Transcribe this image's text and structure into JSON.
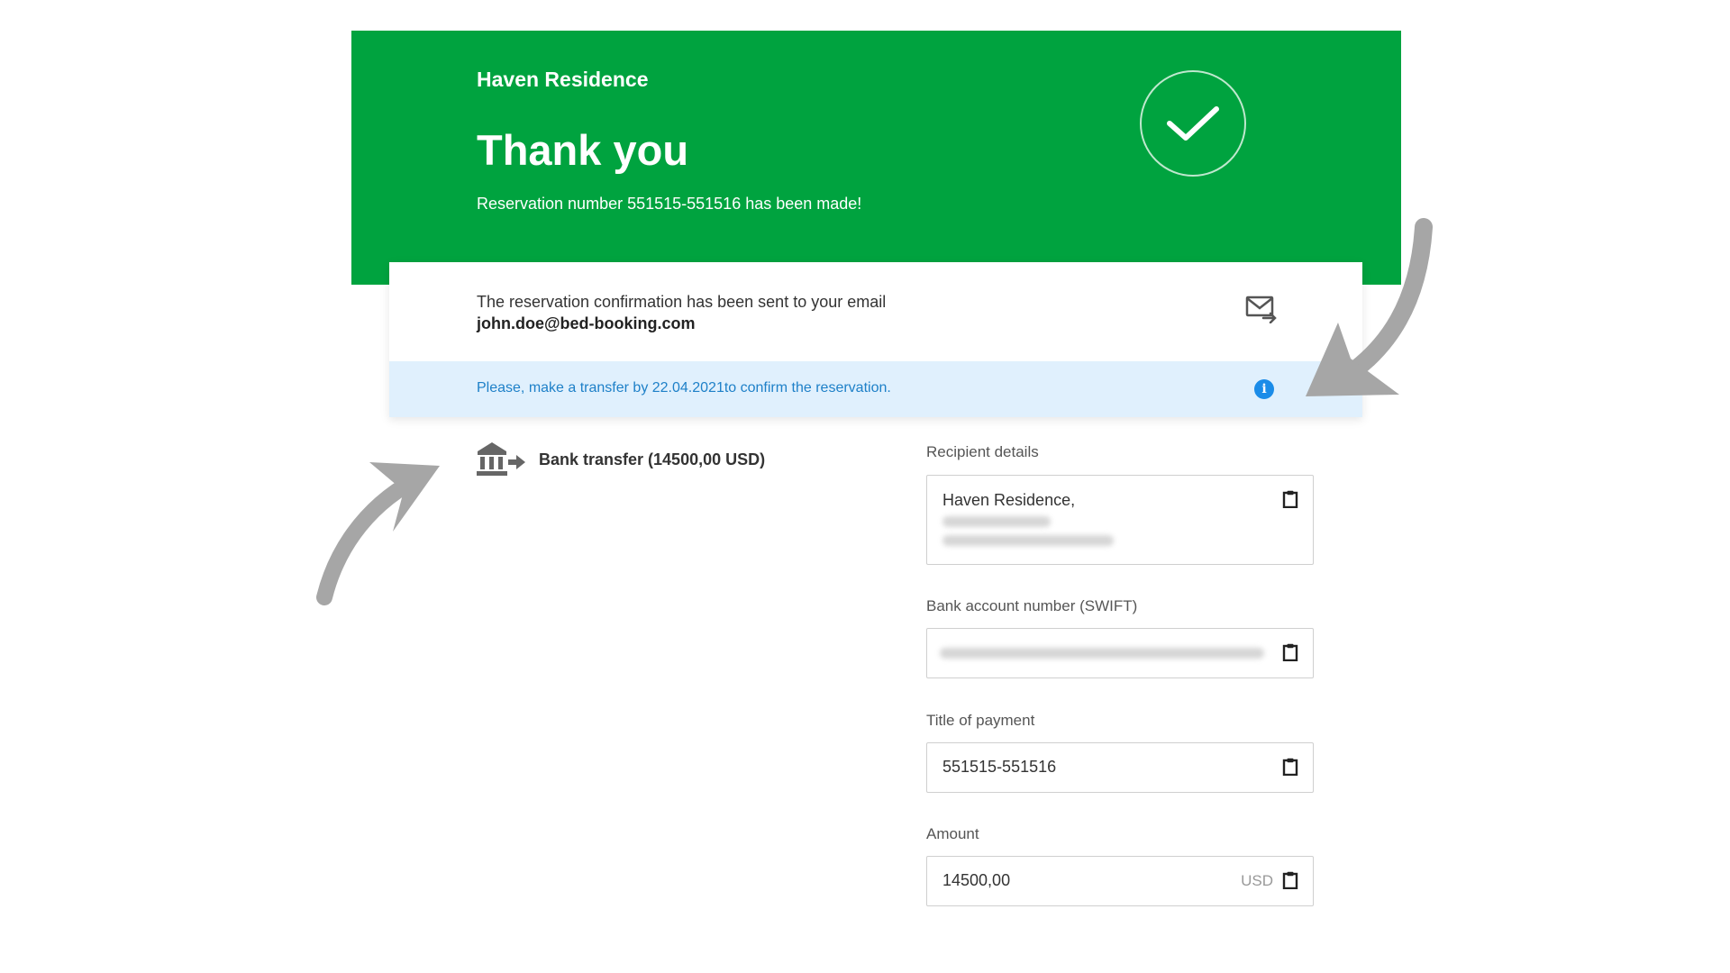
{
  "header": {
    "brand": "Haven Residence",
    "title": "Thank you",
    "subtitle": "Reservation number 551515-551516 has been made!"
  },
  "confirmation": {
    "text": "The reservation confirmation has been sent to your email",
    "email": "john.doe@bed-booking.com"
  },
  "notice": {
    "text": "Please, make a transfer by 22.04.2021to confirm the reservation."
  },
  "payment": {
    "method_label": "Bank transfer (14500,00 USD)"
  },
  "fields": {
    "recipient": {
      "label": "Recipient details",
      "value": "Haven Residence,"
    },
    "account": {
      "label": "Bank account number (SWIFT)"
    },
    "title": {
      "label": "Title of payment",
      "value": "551515-551516"
    },
    "amount": {
      "label": "Amount",
      "value": "14500,00",
      "unit": "USD"
    }
  },
  "colors": {
    "header_bg": "#00a33f",
    "notice_bg": "#e0f0fd",
    "notice_text": "#1e80c8",
    "info_icon": "#1b8ce8",
    "arrow": "#a6a6a6"
  },
  "icons": [
    "check-circle-icon",
    "mail-forward-icon",
    "info-icon",
    "bank-transfer-icon",
    "clipboard-icon"
  ]
}
